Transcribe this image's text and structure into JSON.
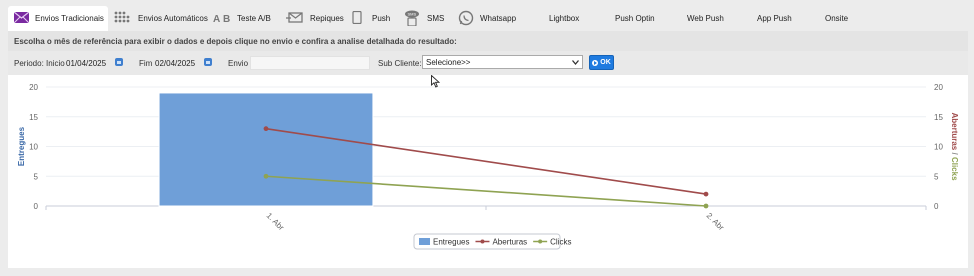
{
  "tabs": [
    {
      "label": "Envios Tradicionais",
      "icon": "envelope-icon",
      "active": true
    },
    {
      "label": "Envios Automáticos",
      "icon": "grid-dots-icon",
      "active": false
    },
    {
      "label": "Teste A/B",
      "icon": "ab-icon",
      "active": false
    },
    {
      "label": "Repiques",
      "icon": "mail-repeat-icon",
      "active": false
    },
    {
      "label": "Push",
      "icon": "mobile-phone-icon",
      "active": false
    },
    {
      "label": "SMS",
      "icon": "sms-phone-icon",
      "active": false
    },
    {
      "label": "Whatsapp",
      "icon": "whatsapp-icon",
      "active": false
    },
    {
      "label": "Lightbox",
      "icon": "",
      "active": false
    },
    {
      "label": "Push Optin",
      "icon": "",
      "active": false
    },
    {
      "label": "Web Push",
      "icon": "",
      "active": false
    },
    {
      "label": "App Push",
      "icon": "",
      "active": false
    },
    {
      "label": "Onsite",
      "icon": "",
      "active": false
    }
  ],
  "notice": "Escolha o mês de referência para exibir o dados e depois clique no envio e confira a analise detalhada do resultado:",
  "filters": {
    "period_label": "Periodo: Inicio",
    "start_date": "01/04/2025",
    "end_label": "Fim",
    "end_date": "02/04/2025",
    "envio_label": "Envio",
    "envio_value": "",
    "subclient_label": "Sub Cliente:",
    "subclient_value": "Selecione>>",
    "ok_label": "OK"
  },
  "chart_data": {
    "type": "bar",
    "categories": [
      "1. Abr",
      "2. Abr"
    ],
    "series": [
      {
        "name": "Entregues",
        "type": "bar",
        "axis": "left",
        "color": "#6f9fd8",
        "values": [
          19,
          0
        ]
      },
      {
        "name": "Aberturas",
        "type": "line",
        "axis": "right",
        "color": "#a04b4b",
        "values": [
          13,
          2
        ]
      },
      {
        "name": "Clicks",
        "type": "line",
        "axis": "right",
        "color": "#8fa352",
        "values": [
          5,
          0
        ]
      }
    ],
    "ylabel_left": "Entregues",
    "ylabel_right": [
      "Aberturas",
      "/",
      "Clicks"
    ],
    "ylim_left": [
      0,
      20
    ],
    "ylim_right": [
      0,
      20
    ],
    "yticks": [
      "0",
      "5",
      "10",
      "15",
      "20"
    ],
    "legend_position": "bottom-center",
    "grid": true
  }
}
